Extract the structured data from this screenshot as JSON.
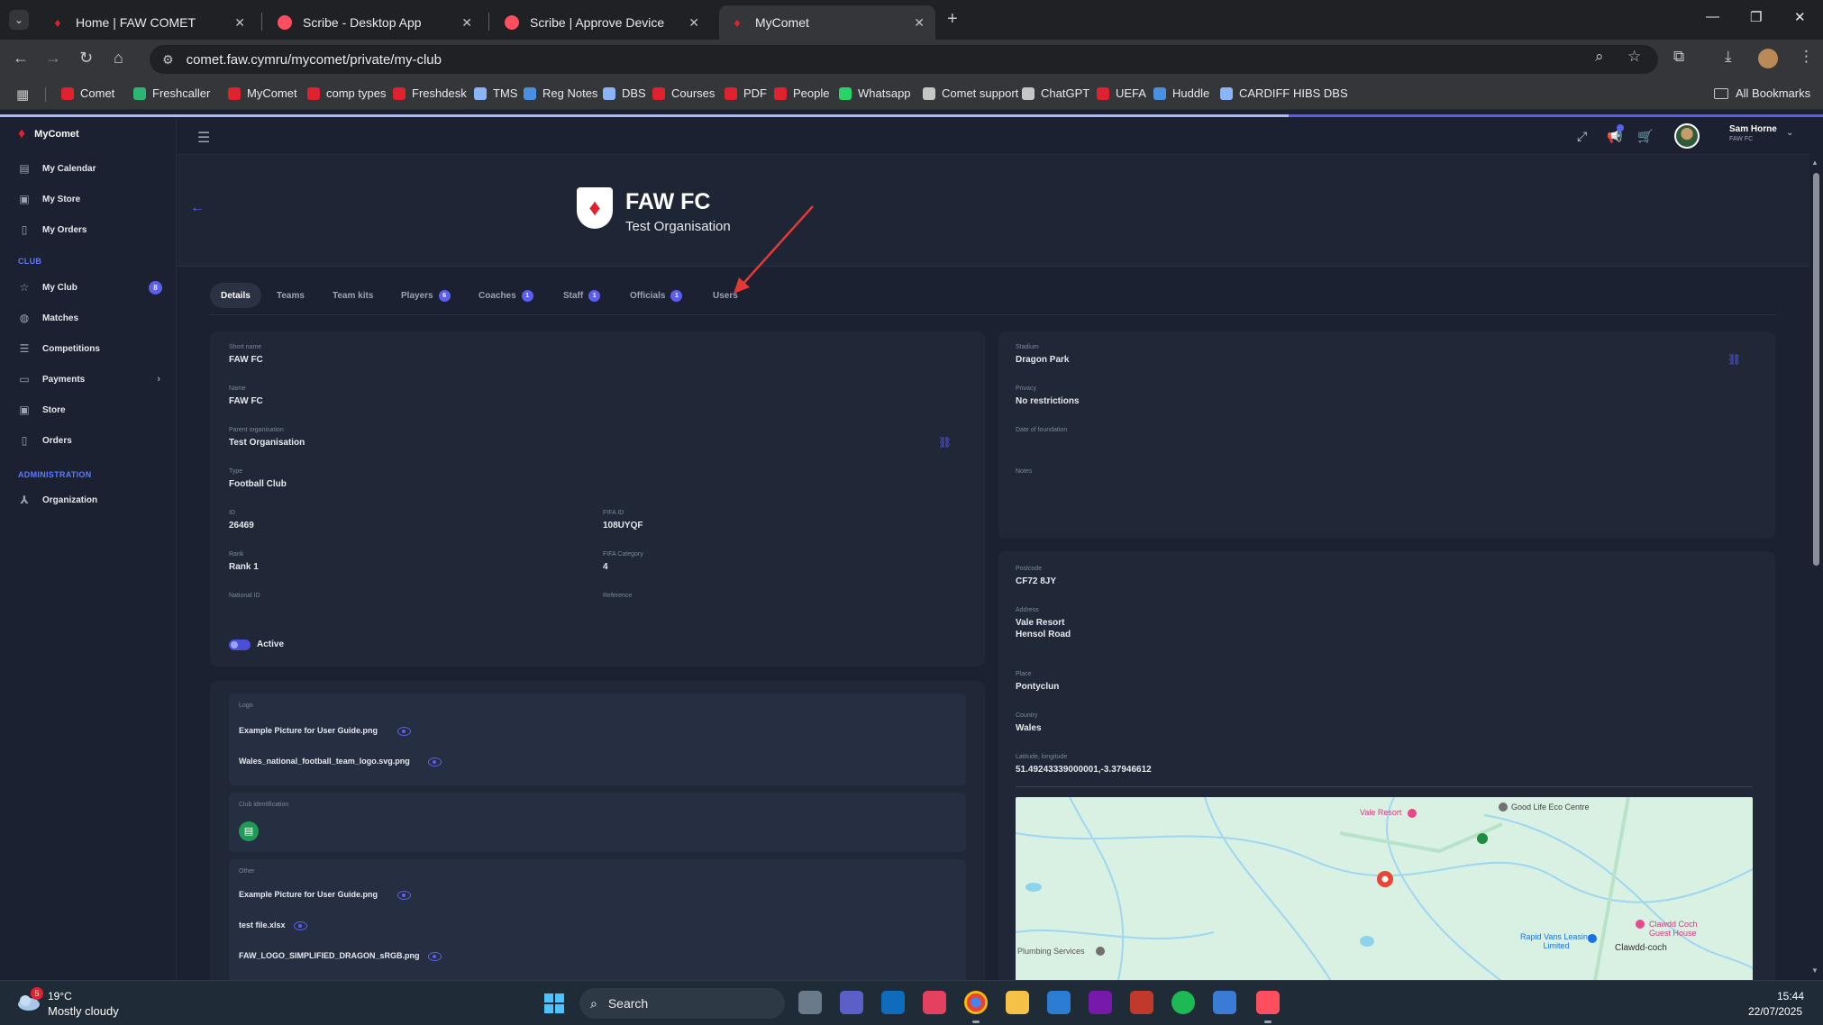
{
  "browser": {
    "tabs": [
      {
        "title": "Home | FAW COMET",
        "favicon": "dragon-icon",
        "active": false
      },
      {
        "title": "Scribe - Desktop App",
        "favicon": "scribe-icon",
        "active": false
      },
      {
        "title": "Scribe | Approve Device",
        "favicon": "scribe-icon",
        "active": false
      },
      {
        "title": "MyComet",
        "favicon": "dragon-icon",
        "active": true
      }
    ],
    "url": "comet.faw.cymru/mycomet/private/my-club",
    "bookmarks": [
      {
        "label": "Comet",
        "icon_color": "#e0212e"
      },
      {
        "label": "Freshcaller",
        "icon_color": "#2bb673"
      },
      {
        "label": "MyComet",
        "icon_color": "#e0212e"
      },
      {
        "label": "comp types",
        "icon_color": "#e0212e"
      },
      {
        "label": "Freshdesk",
        "icon_color": "#e0212e"
      },
      {
        "label": "TMS",
        "icon_color": "#8ab4f8"
      },
      {
        "label": "Reg Notes",
        "icon_color": "#4a90e2"
      },
      {
        "label": "DBS",
        "icon_color": "#8ab4f8"
      },
      {
        "label": "Courses",
        "icon_color": "#e0212e"
      },
      {
        "label": "PDF",
        "icon_color": "#e0212e"
      },
      {
        "label": "People",
        "icon_color": "#e0212e"
      },
      {
        "label": "Whatsapp",
        "icon_color": "#25d366"
      },
      {
        "label": "Comet support",
        "icon_color": "#c4c7c5"
      },
      {
        "label": "ChatGPT",
        "icon_color": "#c4c7c5"
      },
      {
        "label": "UEFA",
        "icon_color": "#e0212e"
      },
      {
        "label": "Huddle",
        "icon_color": "#4a90e2"
      },
      {
        "label": "CARDIFF HIBS DBS",
        "icon_color": "#8ab4f8"
      }
    ],
    "all_bookmarks": "All Bookmarks"
  },
  "sidebar": {
    "brand": "MyComet",
    "top_items": [
      {
        "label": "My Calendar",
        "icon": "calendar-icon"
      },
      {
        "label": "My Store",
        "icon": "store-icon"
      },
      {
        "label": "My Orders",
        "icon": "orders-icon"
      }
    ],
    "club_section": "CLUB",
    "club_items": [
      {
        "label": "My Club",
        "icon": "star-icon",
        "badge": "8"
      },
      {
        "label": "Matches",
        "icon": "ball-icon"
      },
      {
        "label": "Competitions",
        "icon": "list-icon"
      },
      {
        "label": "Payments",
        "icon": "card-icon"
      },
      {
        "label": "Store",
        "icon": "store-icon"
      },
      {
        "label": "Orders",
        "icon": "orders-icon"
      }
    ],
    "admin_section": "ADMINISTRATION",
    "admin_items": [
      {
        "label": "Organization",
        "icon": "org-icon"
      }
    ]
  },
  "topbar": {
    "user_name": "Sam Horne",
    "user_club": "FAW FC"
  },
  "header": {
    "club_name": "FAW FC",
    "parent_org": "Test Organisation"
  },
  "subtabs": [
    {
      "label": "Details",
      "count": null,
      "active": true
    },
    {
      "label": "Teams",
      "count": null
    },
    {
      "label": "Team kits",
      "count": null
    },
    {
      "label": "Players",
      "count": "6"
    },
    {
      "label": "Coaches",
      "count": "1"
    },
    {
      "label": "Staff",
      "count": "1"
    },
    {
      "label": "Officials",
      "count": "1"
    },
    {
      "label": "Users",
      "count": null
    }
  ],
  "details": {
    "short_name": {
      "label": "Short name",
      "value": "FAW FC"
    },
    "name": {
      "label": "Name",
      "value": "FAW FC"
    },
    "parent_org": {
      "label": "Parent organisation",
      "value": "Test Organisation"
    },
    "type": {
      "label": "Type",
      "value": "Football Club"
    },
    "id": {
      "label": "ID",
      "value": "26469"
    },
    "fifa_id": {
      "label": "FIFA ID",
      "value": "108UYQF"
    },
    "rank": {
      "label": "Rank",
      "value": "Rank 1"
    },
    "fifa_category": {
      "label": "FIFA Category",
      "value": "4"
    },
    "national_id": {
      "label": "National ID",
      "value": ""
    },
    "reference": {
      "label": "Reference",
      "value": ""
    },
    "active_label": "Active"
  },
  "stadium": {
    "stadium": {
      "label": "Stadium",
      "value": "Dragon Park"
    },
    "privacy": {
      "label": "Privacy",
      "value": "No restrictions"
    },
    "foundation": {
      "label": "Date of foundation",
      "value": ""
    },
    "notes": {
      "label": "Notes",
      "value": ""
    }
  },
  "address": {
    "postcode": {
      "label": "Postcode",
      "value": "CF72 8JY"
    },
    "address_label": "Address",
    "address_line1": "Vale Resort",
    "address_line2": "Hensol Road",
    "place": {
      "label": "Place",
      "value": "Pontyclun"
    },
    "country": {
      "label": "Country",
      "value": "Wales"
    },
    "latlng": {
      "label": "Latitude, longitude",
      "value": "51.49243339000001,-3.37946612"
    }
  },
  "files": {
    "logo_label": "Logo",
    "logo_files": [
      "Example Picture for User Guide.png",
      "Wales_national_football_team_logo.svg.png"
    ],
    "club_id_label": "Club identification",
    "other_label": "Other",
    "other_files": [
      "Example Picture for User Guide.png",
      "test file.xlsx",
      "FAW_LOGO_SIMPLIFIED_DRAGON_sRGB.png"
    ]
  },
  "map": {
    "labels": [
      "Vale Resort",
      "Good Life Eco Centre",
      "Rapid Vans Leasing Limited",
      "Clawdd Coch Guest House",
      "Clawdd-coch",
      "Plumbing Services"
    ]
  },
  "taskbar": {
    "weather_badge": "5",
    "temperature": "19°C",
    "weather": "Mostly cloudy",
    "search": "Search",
    "time": "15:44",
    "date": "22/07/2025"
  }
}
